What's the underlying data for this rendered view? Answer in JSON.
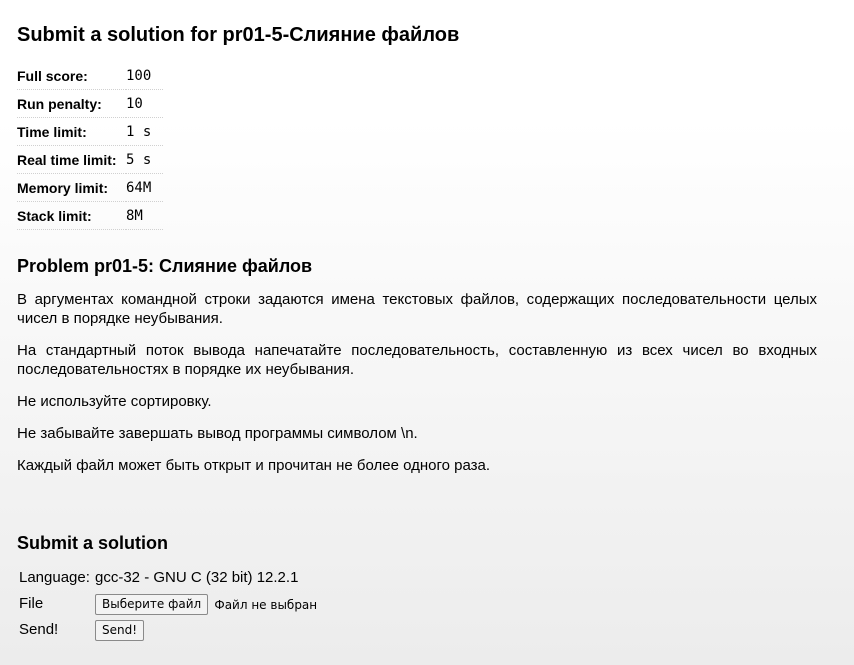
{
  "page": {
    "title": "Submit a solution for pr01-5-Слияние файлов"
  },
  "limits": [
    {
      "label": "Full score:",
      "value": "100"
    },
    {
      "label": "Run penalty:",
      "value": "10"
    },
    {
      "label": "Time limit:",
      "value": "1 s"
    },
    {
      "label": "Real time limit:",
      "value": "5 s"
    },
    {
      "label": "Memory limit:",
      "value": "64M"
    },
    {
      "label": "Stack limit:",
      "value": "8M"
    }
  ],
  "problem": {
    "heading": "Problem pr01-5: Слияние файлов",
    "paragraphs": [
      "В аргументах командной строки задаются имена текстовых файлов, содержащих последовательности целых чисел в порядке неубывания.",
      "На стандартный поток вывода напечатайте последовательность, составленную из всех чисел во входных последовательностях в порядке их неубывания.",
      "Не используйте сортировку.",
      "Не забывайте завершать вывод программы символом \\n.",
      "Каждый файл может быть открыт и прочитан не более одного раза."
    ]
  },
  "submit": {
    "heading": "Submit a solution",
    "language_label": "Language:",
    "language_value": "gcc-32 - GNU C (32 bit) 12.2.1",
    "file_label": "File",
    "file_button": "Выберите файл",
    "file_status": "Файл не выбран",
    "send_label": "Send!",
    "send_button": "Send!"
  }
}
